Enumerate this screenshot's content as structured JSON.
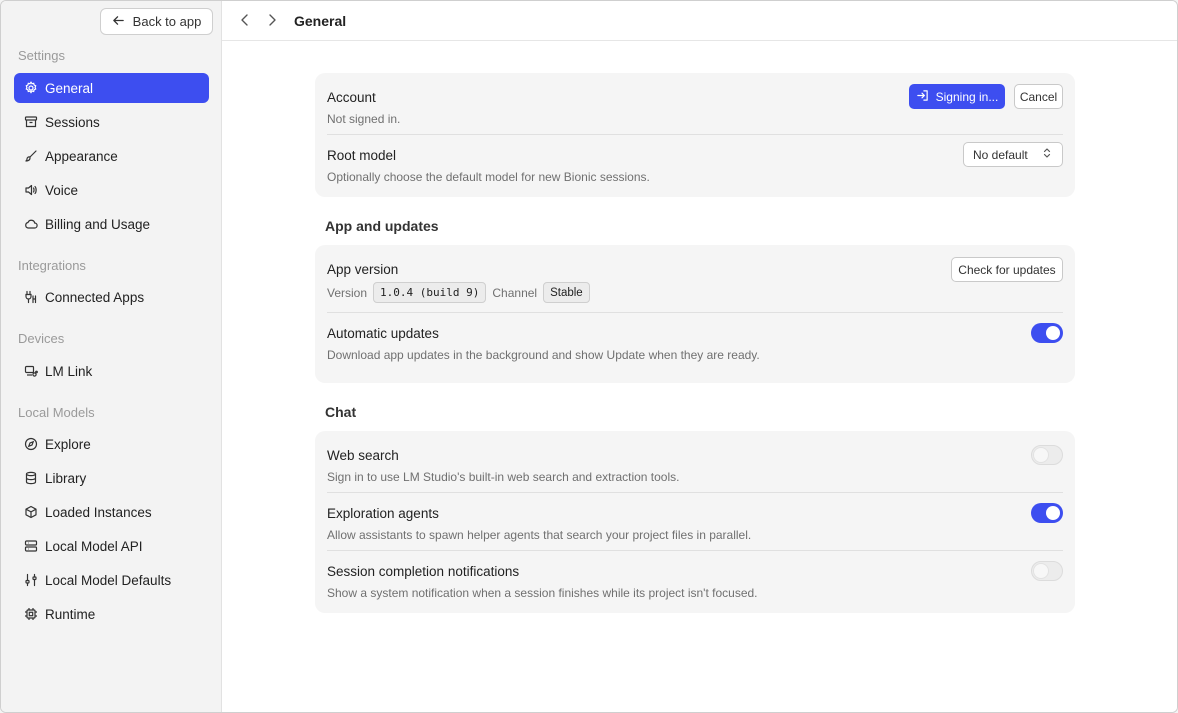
{
  "sidebar": {
    "back_label": "Back to app",
    "sections": {
      "settings": "Settings",
      "integrations": "Integrations",
      "devices": "Devices",
      "local_models": "Local Models"
    },
    "items": {
      "general": {
        "label": "General",
        "icon": "gear-icon"
      },
      "sessions": {
        "label": "Sessions",
        "icon": "archive-icon"
      },
      "appearance": {
        "label": "Appearance",
        "icon": "brush-icon"
      },
      "voice": {
        "label": "Voice",
        "icon": "speaker-icon"
      },
      "billing": {
        "label": "Billing and Usage",
        "icon": "cloud-icon"
      },
      "connected_apps": {
        "label": "Connected Apps",
        "icon": "plug-icon"
      },
      "lm_link": {
        "label": "LM Link",
        "icon": "link-device-icon"
      },
      "explore": {
        "label": "Explore",
        "icon": "compass-icon"
      },
      "library": {
        "label": "Library",
        "icon": "database-icon"
      },
      "loaded_instances": {
        "label": "Loaded Instances",
        "icon": "cube-icon"
      },
      "local_model_api": {
        "label": "Local Model API",
        "icon": "server-icon"
      },
      "local_model_defaults": {
        "label": "Local Model Defaults",
        "icon": "sliders-icon"
      },
      "runtime": {
        "label": "Runtime",
        "icon": "chip-icon"
      }
    },
    "active": "general",
    "accent": "#3d4ef0"
  },
  "header": {
    "title": "General"
  },
  "account": {
    "title": "Account",
    "status": "Not signed in.",
    "signing_in_label": "Signing in...",
    "cancel_label": "Cancel"
  },
  "root_model": {
    "title": "Root model",
    "desc": "Optionally choose the default model for new Bionic sessions.",
    "selected": "No default"
  },
  "app_updates": {
    "heading": "App and updates",
    "version_title": "App version",
    "version_label": "Version",
    "version_value": "1.0.4 (build 9)",
    "channel_label": "Channel",
    "channel_value": "Stable",
    "check_label": "Check for updates",
    "auto_title": "Automatic updates",
    "auto_desc": "Download app updates in the background and show Update when they are ready.",
    "auto_enabled": true
  },
  "chat": {
    "heading": "Chat",
    "web_search_title": "Web search",
    "web_search_desc": "Sign in to use LM Studio's built-in web search and extraction tools.",
    "web_search_enabled": false,
    "exploration_title": "Exploration agents",
    "exploration_desc": "Allow assistants to spawn helper agents that search your project files in parallel.",
    "exploration_enabled": true,
    "notif_title": "Session completion notifications",
    "notif_desc": "Show a system notification when a session finishes while its project isn't focused.",
    "notif_enabled": false
  }
}
